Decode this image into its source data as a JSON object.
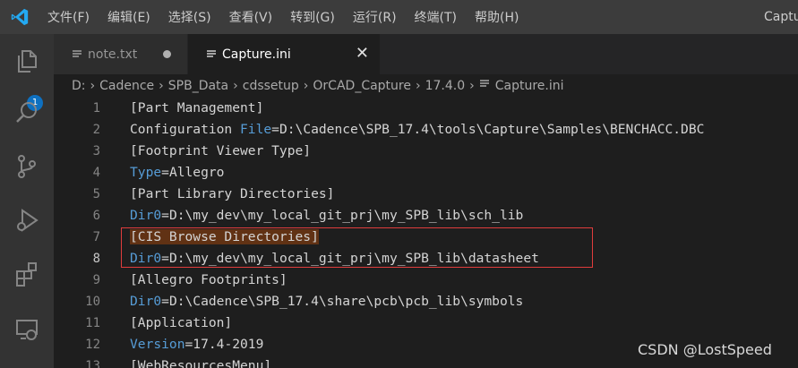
{
  "menu": {
    "items": [
      "文件(F)",
      "编辑(E)",
      "选择(S)",
      "查看(V)",
      "转到(G)",
      "运行(R)",
      "终端(T)",
      "帮助(H)"
    ],
    "window_title": "Capture.ini - Visual Studio Code"
  },
  "activity_bar": {
    "icons": [
      "explorer-icon",
      "search-icon",
      "source-control-icon",
      "run-debug-icon",
      "extensions-icon",
      "remote-explorer-icon"
    ],
    "explorer_badge": "1"
  },
  "tabs": [
    {
      "label": "note.txt",
      "state": "modified"
    },
    {
      "label": "Capture.ini",
      "state": "active"
    }
  ],
  "breadcrumb": [
    "D:",
    "Cadence",
    "SPB_Data",
    "cdssetup",
    "OrCAD_Capture",
    "17.4.0",
    "Capture.ini"
  ],
  "editor": {
    "current_line": 8,
    "lines": [
      {
        "num": "1",
        "parts": [
          {
            "text": "[Part Management]",
            "cls": ""
          }
        ]
      },
      {
        "num": "2",
        "parts": [
          {
            "text": "Configuration ",
            "cls": ""
          },
          {
            "text": "File",
            "cls": "k"
          },
          {
            "text": "=D:\\Cadence\\SPB_17.4\\tools\\Capture\\Samples\\BENCHACC.DBC",
            "cls": ""
          }
        ]
      },
      {
        "num": "3",
        "parts": [
          {
            "text": "[Footprint Viewer Type]",
            "cls": ""
          }
        ]
      },
      {
        "num": "4",
        "parts": [
          {
            "text": "Type",
            "cls": "k"
          },
          {
            "text": "=Allegro",
            "cls": ""
          }
        ]
      },
      {
        "num": "5",
        "parts": [
          {
            "text": "[Part Library Directories]",
            "cls": ""
          }
        ]
      },
      {
        "num": "6",
        "parts": [
          {
            "text": "Dir0",
            "cls": "k"
          },
          {
            "text": "=D:\\my_dev\\my_local_git_prj\\my_SPB_lib\\sch_lib",
            "cls": ""
          }
        ]
      },
      {
        "num": "7",
        "parts": [
          {
            "text": "[CIS Browse Directories]",
            "cls": "hl"
          }
        ]
      },
      {
        "num": "8",
        "parts": [
          {
            "text": "Dir0",
            "cls": "k"
          },
          {
            "text": "=D:\\my_dev\\my_local_git_prj\\my_SPB_lib\\datasheet",
            "cls": ""
          }
        ]
      },
      {
        "num": "9",
        "parts": [
          {
            "text": "[Allegro Footprints]",
            "cls": ""
          }
        ]
      },
      {
        "num": "10",
        "parts": [
          {
            "text": "Dir0",
            "cls": "k"
          },
          {
            "text": "=D:\\Cadence\\SPB_17.4\\share\\pcb\\pcb_lib\\symbols",
            "cls": ""
          }
        ]
      },
      {
        "num": "11",
        "parts": [
          {
            "text": "[Application]",
            "cls": ""
          }
        ]
      },
      {
        "num": "12",
        "parts": [
          {
            "text": "Version",
            "cls": "k"
          },
          {
            "text": "=17.4-2019",
            "cls": ""
          }
        ]
      },
      {
        "num": "13",
        "parts": [
          {
            "text": "[WebResourcesMenu]",
            "cls": ""
          }
        ]
      }
    ]
  },
  "watermark": "CSDN @LostSpeed",
  "colors": {
    "accent": "#0e70c0",
    "keyword": "#569cd6",
    "highlight_box": "#e03c3c",
    "selection_highlight": "#613214"
  }
}
